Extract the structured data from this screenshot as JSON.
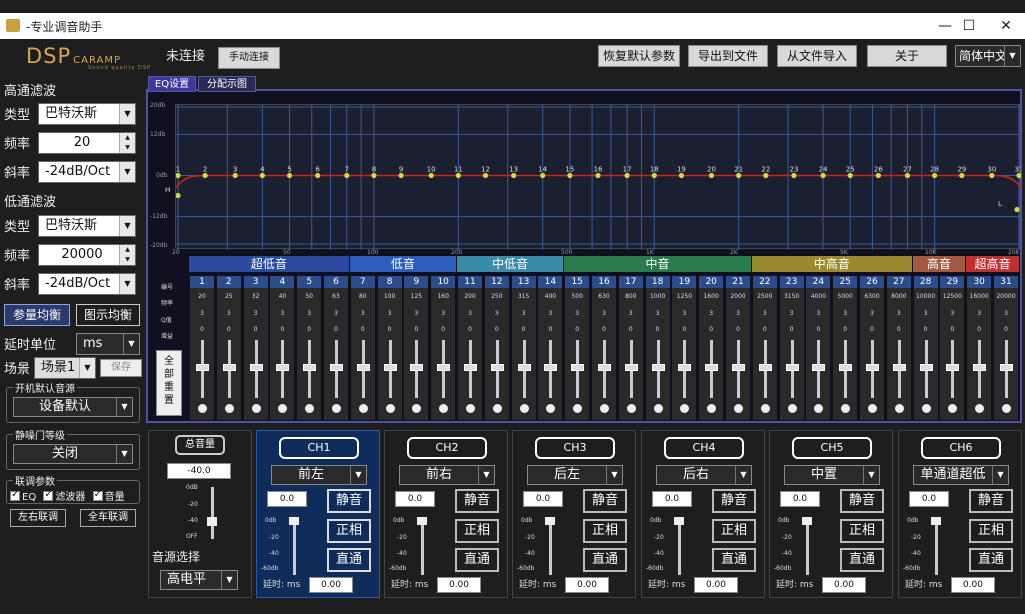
{
  "window": {
    "title": "-专业调音助手",
    "minimize": "—",
    "maximize": "☐",
    "close": "✕"
  },
  "logo": {
    "main": "DSP",
    "side": "CARAMP",
    "sub": "Sound quality DSP"
  },
  "status": "未连接",
  "connect_button": "手动连接",
  "header_buttons": [
    "恢复默认参数",
    "导出到文件",
    "从文件导入",
    "关于"
  ],
  "language": "简体中文",
  "highpass": {
    "title": "高通滤波",
    "type_label": "类型",
    "type": "巴特沃斯",
    "freq_label": "频率",
    "freq": "20",
    "slope_label": "斜率",
    "slope": "-24dB/Oct"
  },
  "lowpass": {
    "title": "低通滤波",
    "type_label": "类型",
    "type": "巴特沃斯",
    "freq_label": "频率",
    "freq": "20000",
    "slope_label": "斜率",
    "slope": "-24dB/Oct"
  },
  "eq_mode": {
    "param": "参量均衡",
    "graphic": "图示均衡"
  },
  "delay_unit": {
    "label": "延时单位",
    "value": "ms"
  },
  "scene": {
    "label": "场景",
    "value": "场景1",
    "save": "保存"
  },
  "boot_source": {
    "title": "开机默认音源",
    "value": "设备默认"
  },
  "noise_gate": {
    "title": "静噪门等级",
    "value": "关闭"
  },
  "link_params": {
    "title": "联调参数",
    "items": [
      "EQ",
      "滤波器",
      "音量"
    ]
  },
  "link_buttons": [
    "左右联调",
    "全车联调"
  ],
  "tabs": [
    "EQ设置",
    "分配示图"
  ],
  "graph": {
    "y_ticks": [
      "20db",
      "12db",
      "0db",
      "-12db",
      "-20db"
    ],
    "x_ticks": [
      "20",
      "50",
      "100",
      "200",
      "500",
      "1K",
      "2K",
      "5K",
      "10K",
      "20K"
    ],
    "marker_h": "H",
    "marker_l": "L"
  },
  "bands": [
    {
      "label": "超低音",
      "color": "#2c4aa0",
      "cols": 6
    },
    {
      "label": "低音",
      "color": "#2c5cbc",
      "cols": 4
    },
    {
      "label": "中低音",
      "color": "#3a8aaa",
      "cols": 4
    },
    {
      "label": "中音",
      "color": "#2a7a50",
      "cols": 7
    },
    {
      "label": "中高音",
      "color": "#9a8a30",
      "cols": 6
    },
    {
      "label": "高音",
      "color": "#a05a40",
      "cols": 2
    },
    {
      "label": "超高音",
      "color": "#c03030",
      "cols": 2
    }
  ],
  "row_labels": [
    "编号",
    "频率",
    "Q值",
    "增益"
  ],
  "reset_button": "全部重置",
  "eq_freqs": [
    "20",
    "25",
    "32",
    "40",
    "50",
    "63",
    "80",
    "100",
    "125",
    "160",
    "200",
    "250",
    "315",
    "400",
    "500",
    "630",
    "800",
    "1000",
    "1250",
    "1600",
    "2000",
    "2500",
    "3150",
    "4000",
    "5000",
    "6300",
    "8000",
    "10000",
    "12500",
    "16000",
    "20000"
  ],
  "eq_q": "3",
  "eq_gain": "0",
  "master": {
    "label": "总音量",
    "value": "-40.0",
    "ticks": [
      "0dB",
      "-20",
      "-40",
      "OFF"
    ],
    "source_label": "音源选择",
    "source": "高电平"
  },
  "channels": [
    {
      "name": "CH1",
      "pos": "前左",
      "active": true
    },
    {
      "name": "CH2",
      "pos": "前右",
      "active": false
    },
    {
      "name": "CH3",
      "pos": "后左",
      "active": false
    },
    {
      "name": "CH4",
      "pos": "后右",
      "active": false
    },
    {
      "name": "CH5",
      "pos": "中置",
      "active": false
    },
    {
      "name": "CH6",
      "pos": "单通道超低",
      "active": false
    }
  ],
  "channel_common": {
    "gain": "0.0",
    "mute": "静音",
    "phase": "正相",
    "bypass": "直通",
    "delay_label": "延时: ms",
    "delay": "0.00",
    "ticks": [
      "0db",
      "-20",
      "-40",
      "-60db"
    ]
  }
}
